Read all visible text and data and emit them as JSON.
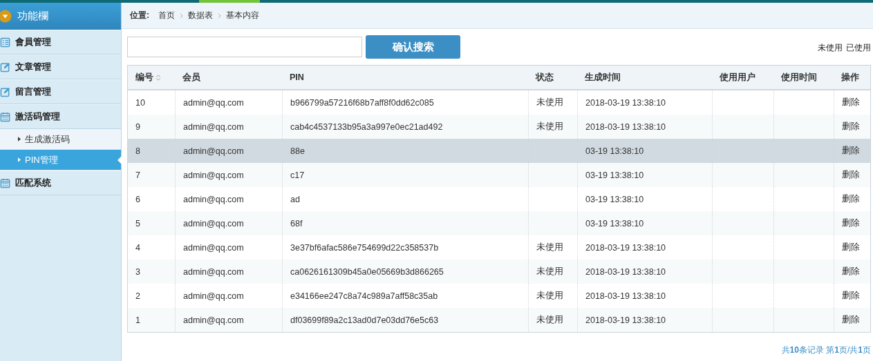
{
  "sidebar": {
    "title": "功能欄",
    "items": [
      {
        "label": "會員管理"
      },
      {
        "label": "文章管理"
      },
      {
        "label": "留言管理"
      },
      {
        "label": "激活码管理",
        "children": [
          {
            "label": "生成激活码",
            "selected": false
          },
          {
            "label": "PIN管理",
            "selected": true
          }
        ]
      },
      {
        "label": "匹配系统"
      }
    ]
  },
  "breadcrumb": {
    "label": "位置:",
    "items": [
      "首页",
      "数据表",
      "基本内容"
    ]
  },
  "search": {
    "button": "确认搜索"
  },
  "filters": [
    "未使用",
    "已使用"
  ],
  "table": {
    "columns": [
      {
        "label": "编号",
        "sortable": true
      },
      {
        "label": "会员",
        "sortable": false
      },
      {
        "label": "PIN",
        "sortable": false
      },
      {
        "label": "状态",
        "sortable": false
      },
      {
        "label": "生成时间",
        "sortable": false
      },
      {
        "label": "使用用户",
        "sortable": false
      },
      {
        "label": "使用时间",
        "sortable": false
      },
      {
        "label": "操作",
        "sortable": false
      }
    ],
    "rows": [
      {
        "selected": false,
        "cells": [
          "10",
          "admin@qq.com",
          "b966799a57216f68b7aff8f0dd62c085",
          "未使用",
          "2018-03-19 13:38:10",
          "",
          "",
          "删除"
        ]
      },
      {
        "selected": false,
        "cells": [
          "9",
          "admin@qq.com",
          "cab4c4537133b95a3a997e0ec21ad492",
          "未使用",
          "2018-03-19 13:38:10",
          "",
          "",
          "删除"
        ]
      },
      {
        "selected": true,
        "cells": [
          "8",
          "admin@qq.com",
          "88e",
          "",
          "03-19 13:38:10",
          "",
          "",
          "删除"
        ]
      },
      {
        "selected": false,
        "cells": [
          "7",
          "admin@qq.com",
          "c17",
          "",
          "03-19 13:38:10",
          "",
          "",
          "删除"
        ]
      },
      {
        "selected": false,
        "cells": [
          "6",
          "admin@qq.com",
          "ad",
          "",
          "03-19 13:38:10",
          "",
          "",
          "删除"
        ]
      },
      {
        "selected": false,
        "cells": [
          "5",
          "admin@qq.com",
          "68f",
          "",
          "03-19 13:38:10",
          "",
          "",
          "删除"
        ]
      },
      {
        "selected": false,
        "cells": [
          "4",
          "admin@qq.com",
          "3e37bf6afac586e754699d22c358537b",
          "未使用",
          "2018-03-19 13:38:10",
          "",
          "",
          "删除"
        ]
      },
      {
        "selected": false,
        "cells": [
          "3",
          "admin@qq.com",
          "ca0626161309b45a0e05669b3d866265",
          "未使用",
          "2018-03-19 13:38:10",
          "",
          "",
          "删除"
        ]
      },
      {
        "selected": false,
        "cells": [
          "2",
          "admin@qq.com",
          "e34166ee247c8a74c989a7aff58c35ab",
          "未使用",
          "2018-03-19 13:38:10",
          "",
          "",
          "删除"
        ]
      },
      {
        "selected": false,
        "cells": [
          "1",
          "admin@qq.com",
          "df03699f89a2c13ad0d7e03dd76e5c63",
          "未使用",
          "2018-03-19 13:38:10",
          "",
          "",
          "删除"
        ]
      }
    ]
  },
  "pagination": "共**10**条记录 第**1**页/共**1**页"
}
